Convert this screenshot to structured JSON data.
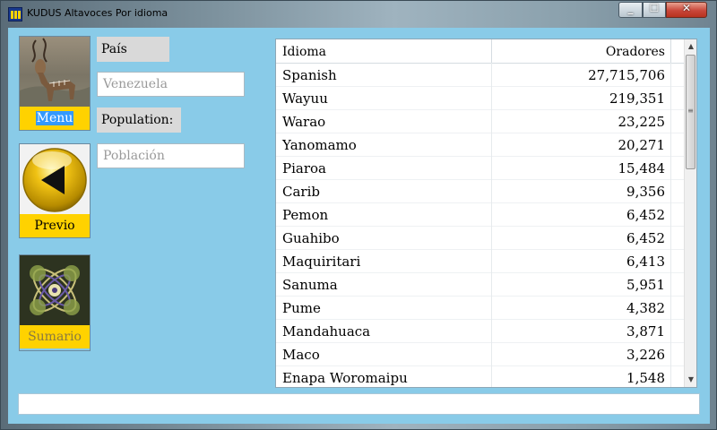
{
  "window": {
    "title": "KUDUS Altavoces Por idioma"
  },
  "controls": {
    "minimize": "_",
    "maximize": "☐",
    "close": "✕"
  },
  "nav": {
    "menu_label": "Menu",
    "previo_label": "Previo",
    "sumario_label": "Sumario"
  },
  "form": {
    "country_label": "País",
    "country_placeholder": "Venezuela",
    "population_label": "Population:",
    "population_placeholder": "Población"
  },
  "grid": {
    "columns": [
      "Idioma",
      "Oradores"
    ],
    "rows": [
      [
        "Spanish",
        "27,715,706"
      ],
      [
        "Wayuu",
        "219,351"
      ],
      [
        "Warao",
        "23,225"
      ],
      [
        "Yanomamo",
        "20,271"
      ],
      [
        "Piaroa",
        "15,484"
      ],
      [
        "Carib",
        "9,356"
      ],
      [
        "Pemon",
        "6,452"
      ],
      [
        "Guahibo",
        "6,452"
      ],
      [
        "Maquiritari",
        "6,413"
      ],
      [
        "Sanuma",
        "5,951"
      ],
      [
        "Pume",
        "4,382"
      ],
      [
        "Mandahuaca",
        "3,871"
      ],
      [
        "Maco",
        "3,226"
      ],
      [
        "Enapa Woromaipu",
        "1,548"
      ]
    ]
  },
  "status": {
    "text": ""
  },
  "colors": {
    "client_bg": "#89cbe8",
    "caption_yellow": "#ffd200",
    "selection_blue": "#3399ff"
  }
}
